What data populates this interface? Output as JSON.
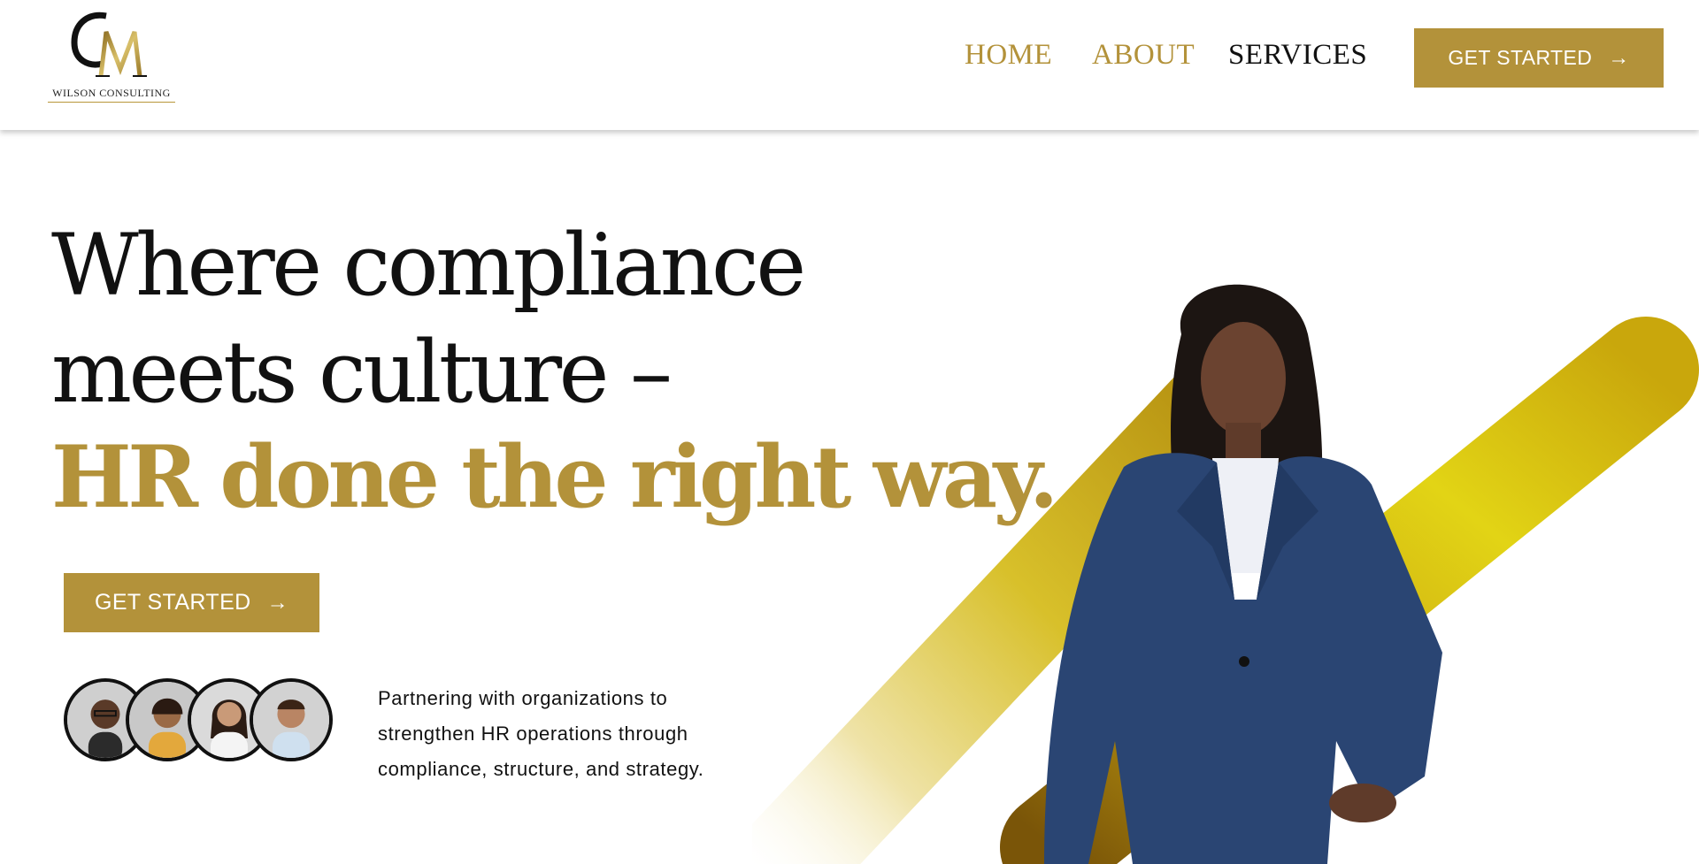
{
  "brand": {
    "monogram": "CM",
    "name": "WILSON CONSULTING",
    "gold": "#b3923a"
  },
  "nav": {
    "home": "HOME",
    "about": "ABOUT",
    "services": "SERVICES",
    "cta_label": "GET STARTED",
    "cta_icon": "arrow-right-icon"
  },
  "hero": {
    "line1": "Where compliance",
    "line2": "meets culture –",
    "line3": "HR done the right way.",
    "cta_label": "GET STARTED",
    "cta_icon": "arrow-right-icon",
    "tagline": [
      "Partnering with organizations to",
      "strengthen HR operations through",
      "compliance, structure, and strategy."
    ],
    "avatars": [
      "client-avatar-1",
      "client-avatar-2",
      "client-avatar-3",
      "client-avatar-4"
    ]
  }
}
